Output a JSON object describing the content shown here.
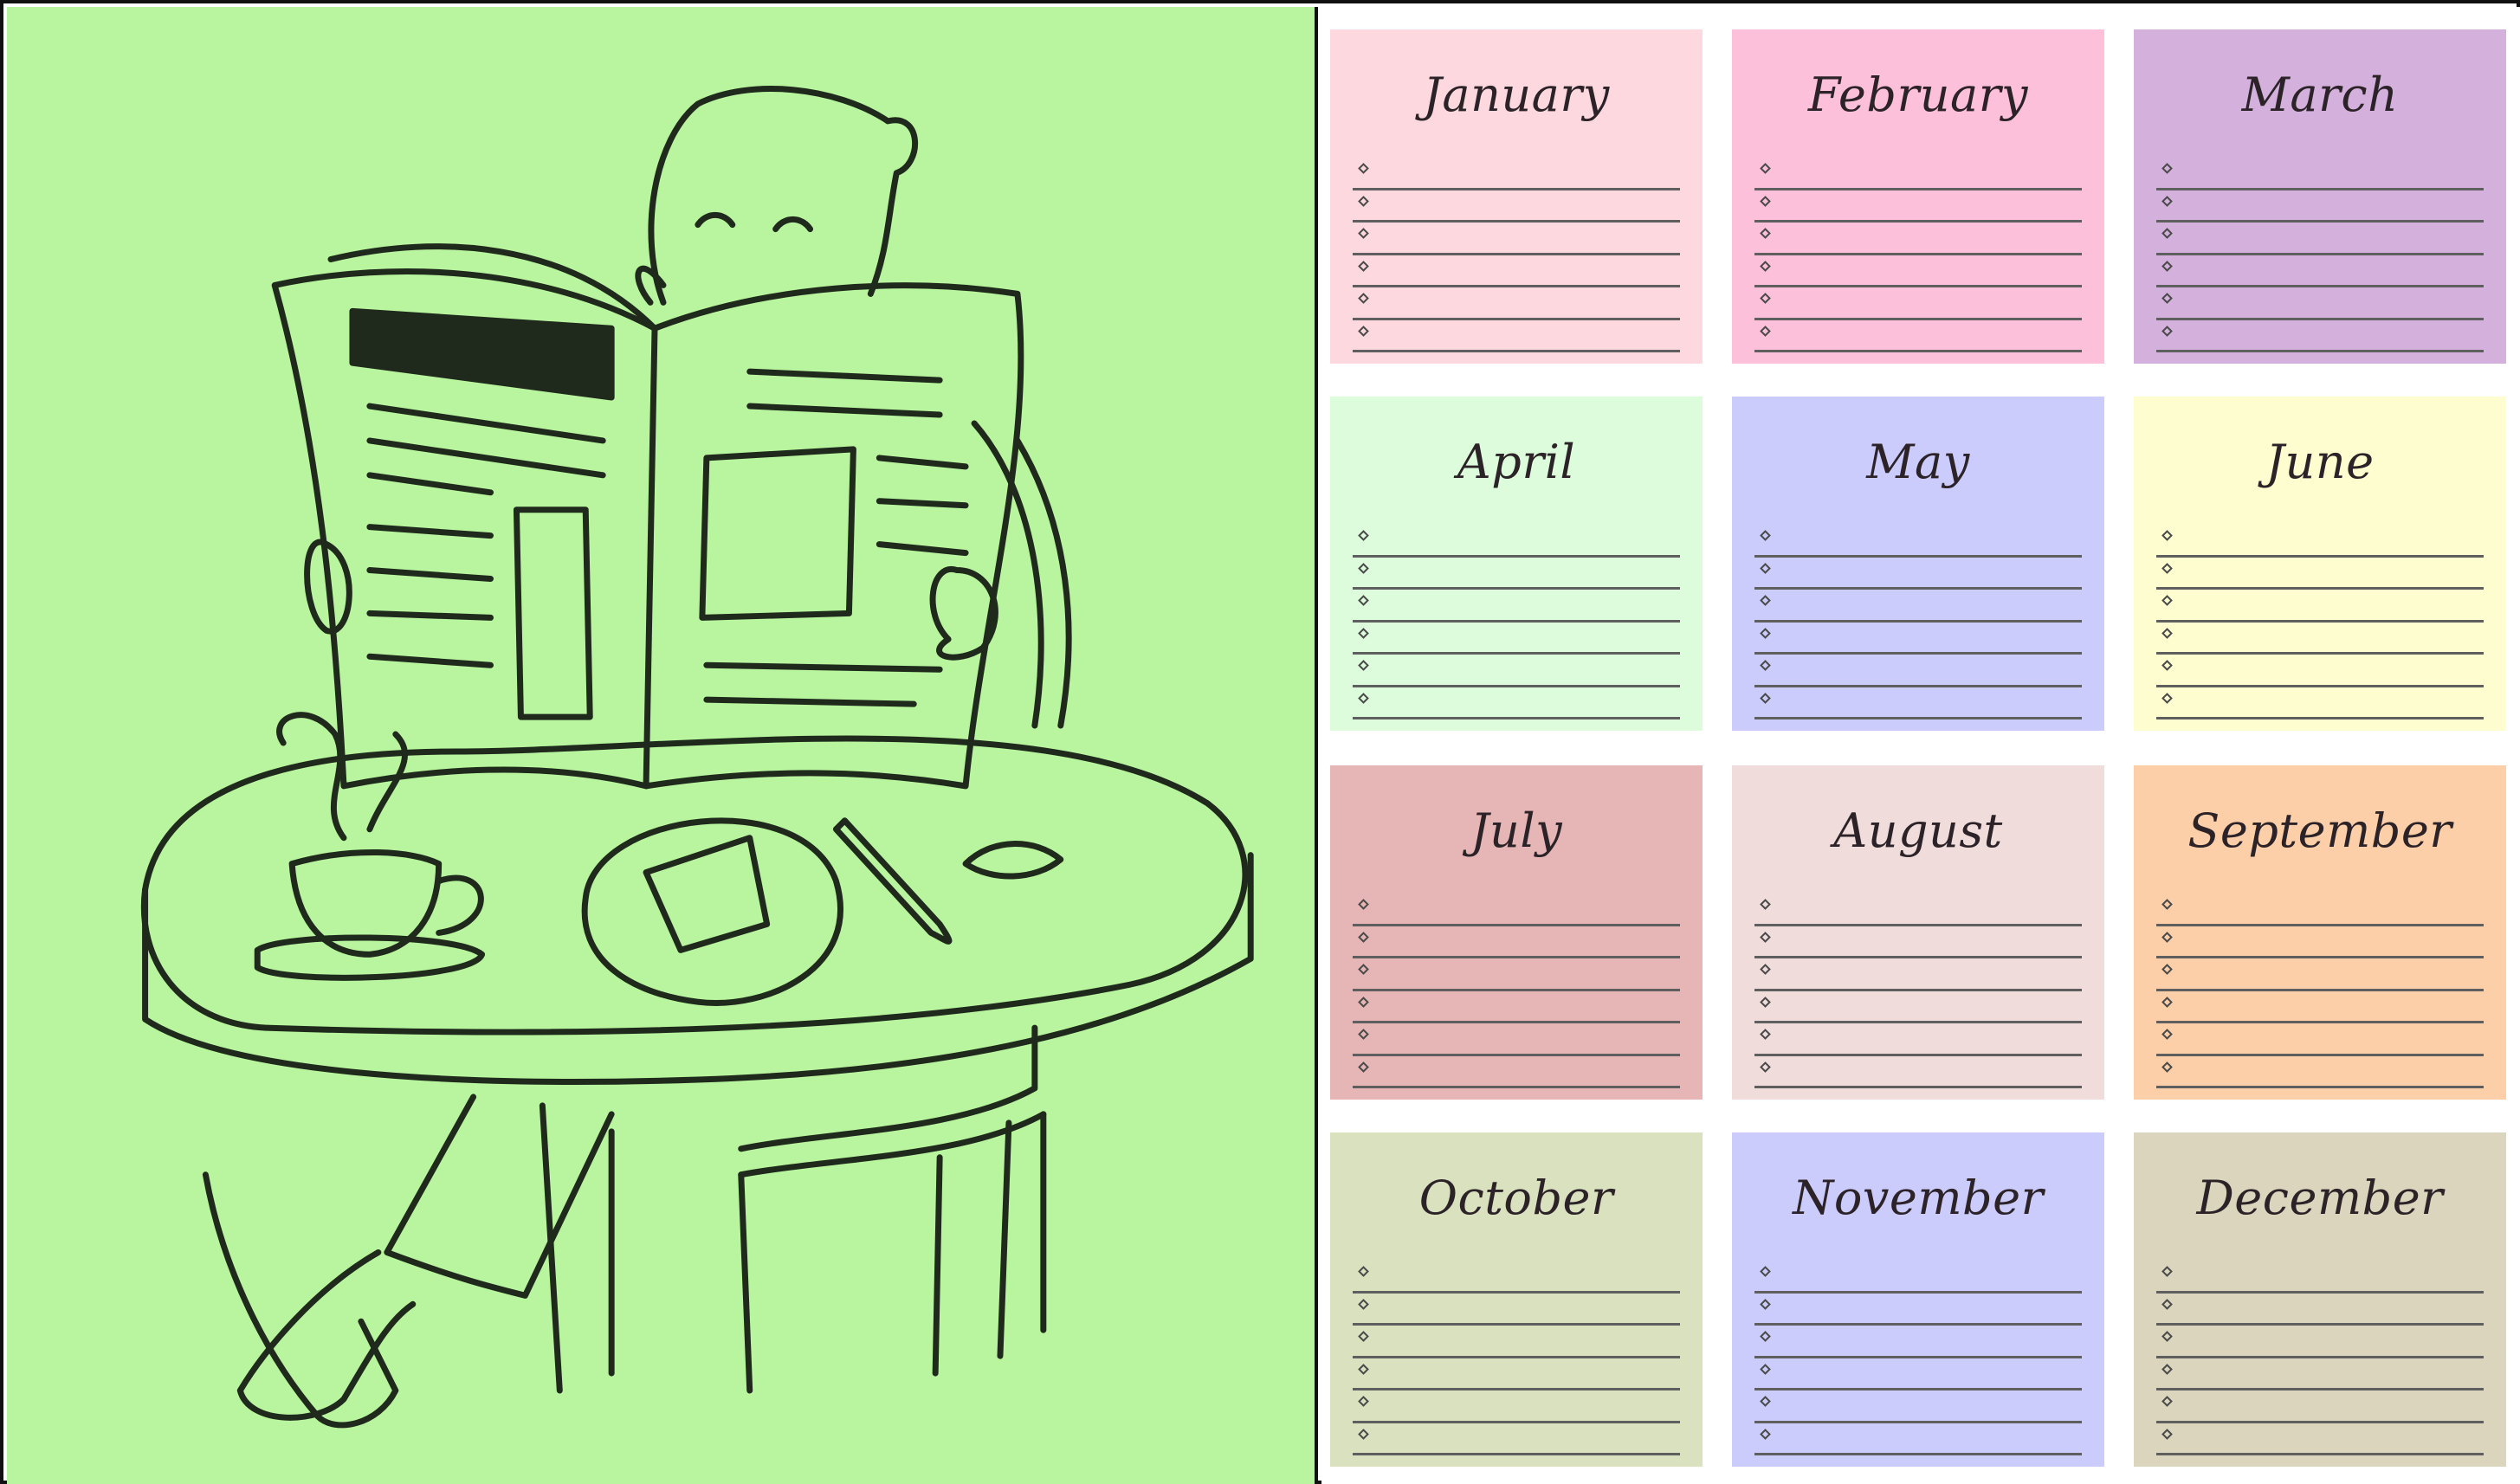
{
  "illustration": {
    "description_icon": "man-reading-newspaper-illustration",
    "background_color": "#b9f59e",
    "line_color": "#1f2a1c"
  },
  "planner": {
    "lines_per_month": 6,
    "months": [
      {
        "name": "January",
        "color": "#fdd8df"
      },
      {
        "name": "February",
        "color": "#fdc0da"
      },
      {
        "name": "March",
        "color": "#d4b0dc"
      },
      {
        "name": "April",
        "color": "#dcfcdc"
      },
      {
        "name": "May",
        "color": "#cbccfc"
      },
      {
        "name": "June",
        "color": "#fefdd0"
      },
      {
        "name": "July",
        "color": "#e5b6b5"
      },
      {
        "name": "August",
        "color": "#f0dcdb"
      },
      {
        "name": "September",
        "color": "#fdcfa9"
      },
      {
        "name": "October",
        "color": "#dae1bf"
      },
      {
        "name": "November",
        "color": "#cbccfc"
      },
      {
        "name": "December",
        "color": "#dad5bc"
      }
    ]
  }
}
